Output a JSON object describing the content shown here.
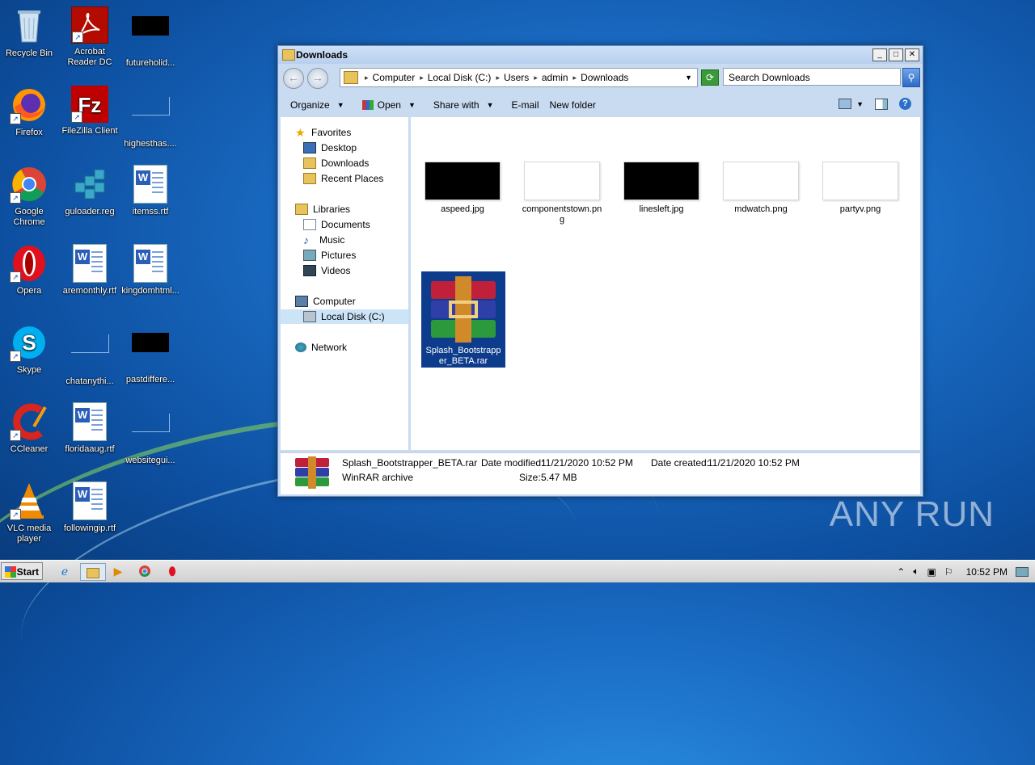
{
  "desktop": {
    "icons": [
      {
        "label": "Recycle Bin"
      },
      {
        "label": "Acrobat Reader DC"
      },
      {
        "label": "futureholid..."
      },
      {
        "label": "Firefox"
      },
      {
        "label": "FileZilla Client"
      },
      {
        "label": "highesthas...."
      },
      {
        "label": "Google Chrome"
      },
      {
        "label": "guloader.reg"
      },
      {
        "label": "itemss.rtf"
      },
      {
        "label": "Opera"
      },
      {
        "label": "aremonthly.rtf"
      },
      {
        "label": "kingdomhtml..."
      },
      {
        "label": "Skype"
      },
      {
        "label": "chatanythi..."
      },
      {
        "label": "pastdiffere..."
      },
      {
        "label": "CCleaner"
      },
      {
        "label": "floridaaug.rtf"
      },
      {
        "label": "websitegui..."
      },
      {
        "label": "VLC media player"
      },
      {
        "label": "followingip.rtf"
      }
    ]
  },
  "window": {
    "title": "Downloads",
    "controls": {
      "minimize": "_",
      "maximize": "□",
      "close": "✕"
    },
    "breadcrumb": [
      "Computer",
      "Local Disk (C:)",
      "Users",
      "admin",
      "Downloads"
    ],
    "search_placeholder": "Search Downloads",
    "toolbar": {
      "organize": "Organize",
      "open": "Open",
      "share_with": "Share with",
      "email": "E-mail",
      "new_folder": "New folder"
    },
    "nav": {
      "favorites": "Favorites",
      "desktop": "Desktop",
      "downloads": "Downloads",
      "recent_places": "Recent Places",
      "libraries": "Libraries",
      "documents": "Documents",
      "music": "Music",
      "pictures": "Pictures",
      "videos": "Videos",
      "computer": "Computer",
      "local_disk": "Local Disk (C:)",
      "network": "Network"
    },
    "files": [
      {
        "name": "aspeed.jpg"
      },
      {
        "name": "componentstown.png"
      },
      {
        "name": "linesleft.jpg"
      },
      {
        "name": "mdwatch.png"
      },
      {
        "name": "partyv.png"
      },
      {
        "name": "Splash_Bootstrapper_BETA.rar"
      }
    ],
    "details": {
      "name": "Splash_Bootstrapper_BETA.rar",
      "type": "WinRAR archive",
      "date_modified_label": "Date modified:",
      "date_modified": "11/21/2020 10:52 PM",
      "size_label": "Size:",
      "size": "5.47 MB",
      "date_created_label": "Date created:",
      "date_created": "11/21/2020 10:52 PM"
    }
  },
  "watermark": "ANY RUN",
  "taskbar": {
    "start": "Start",
    "clock": "10:52 PM"
  }
}
